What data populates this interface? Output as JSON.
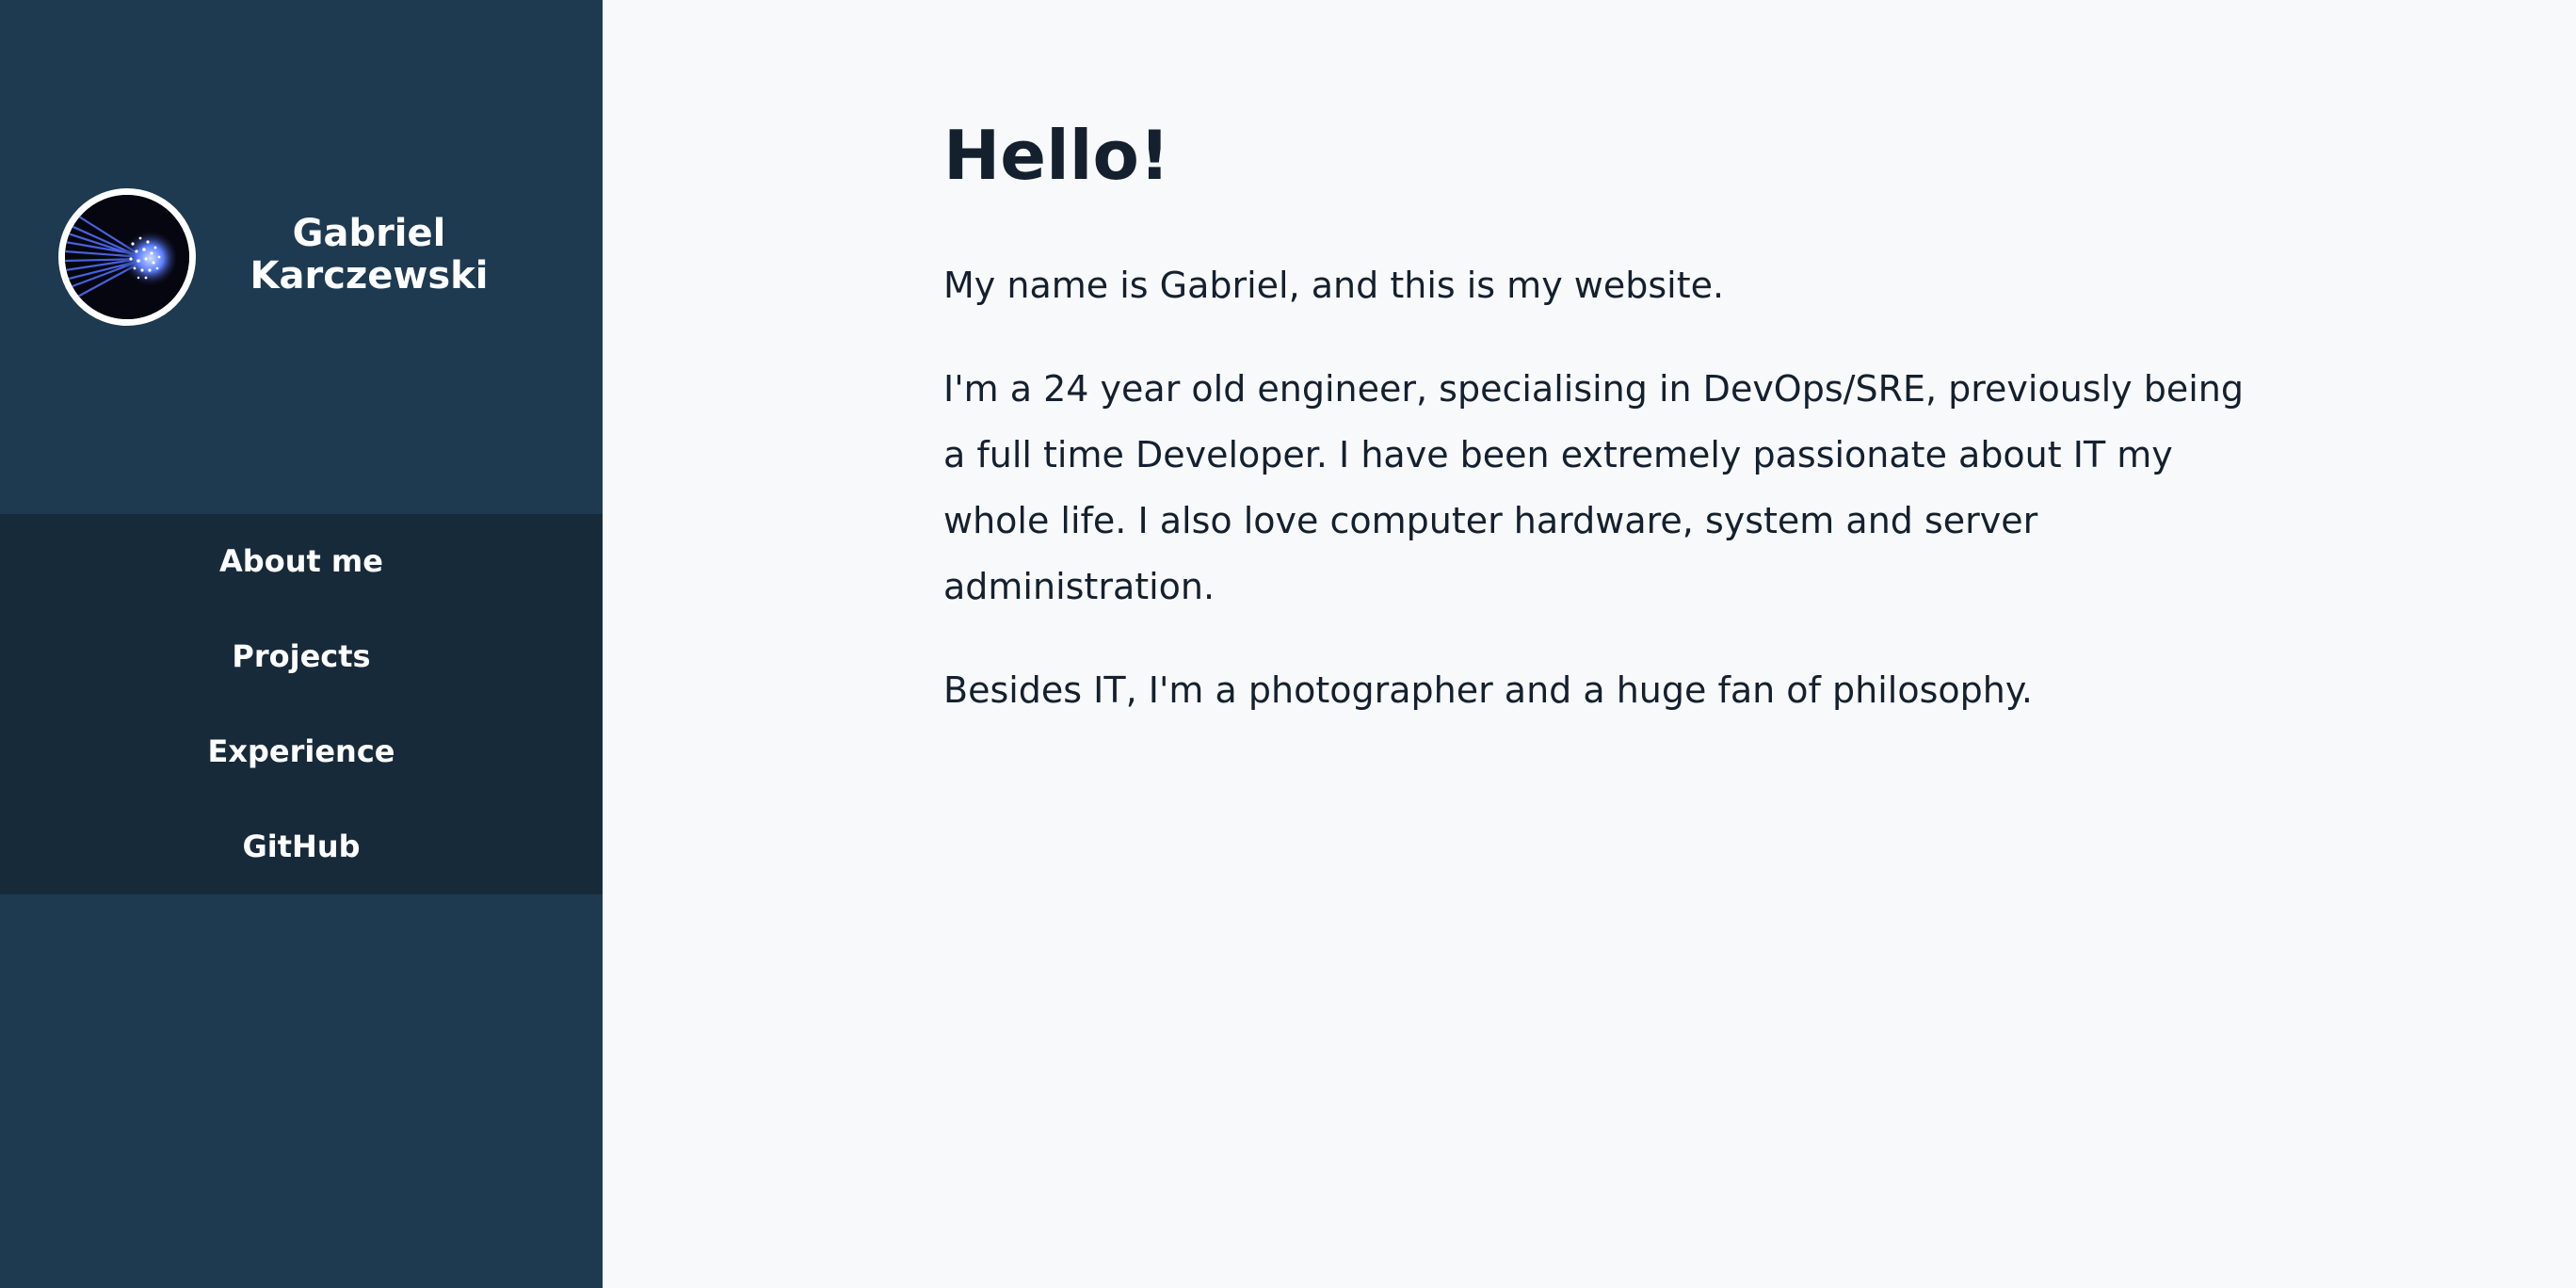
{
  "sidebar": {
    "avatar_icon": "fiber-optic-avatar-icon",
    "name_first": "Gabriel",
    "name_last": "Karczewski",
    "nav": [
      {
        "label": "About me"
      },
      {
        "label": "Projects"
      },
      {
        "label": "Experience"
      },
      {
        "label": "GitHub"
      }
    ]
  },
  "main": {
    "heading": "Hello!",
    "paragraphs": [
      "My name is Gabriel, and this is my website.",
      "I'm a 24 year old engineer, specialising in DevOps/SRE, previously being a full time Developer. I have been extremely passionate about IT my whole life. I also love computer hardware, system and server administration.",
      "Besides IT, I'm a photographer and a huge fan of philosophy."
    ]
  },
  "colors": {
    "sidebar_bg": "#1d3a51",
    "nav_bg": "#172a3a",
    "page_bg": "#f8f9fb",
    "text": "#14202e"
  }
}
